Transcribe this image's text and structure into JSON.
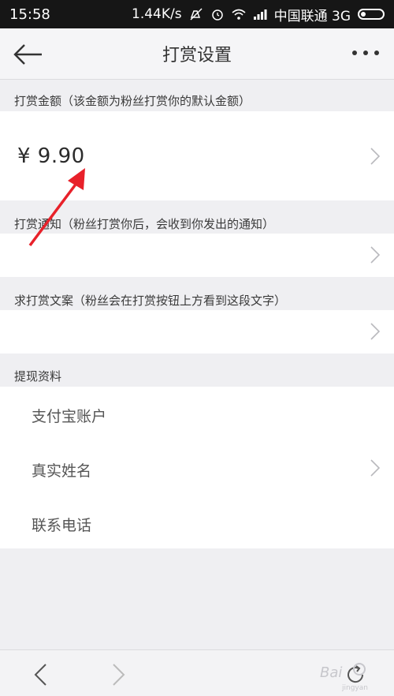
{
  "status_bar": {
    "time": "15:58",
    "speed": "1.44K/s",
    "carrier": "中国联通 3G",
    "icons": [
      "mute-icon",
      "alarm-icon",
      "wifi-icon",
      "signal-icon",
      "battery-icon"
    ]
  },
  "header": {
    "title": "打赏设置",
    "back_icon": "back-arrow-icon",
    "more_icon": "more-dots-icon"
  },
  "sections": {
    "amount": {
      "label": "打赏金额（该金额为粉丝打赏你的默认金额）",
      "value": "¥ 9.90"
    },
    "notice": {
      "label": "打赏通知（粉丝打赏你后，会收到你发出的通知）",
      "value": ""
    },
    "copy": {
      "label": "求打赏文案（粉丝会在打赏按钮上方看到这段文字）",
      "value": ""
    },
    "withdraw": {
      "label": "提现资料",
      "items": [
        "支付宝账户",
        "真实姓名",
        "联系电话"
      ]
    }
  },
  "bottom_bar": {
    "icons": [
      "back-icon",
      "forward-icon",
      "refresh-icon"
    ]
  },
  "colors": {
    "status_bg": "#161616",
    "page_bg": "#efeff2",
    "arrow_annotation": "#e8212a"
  }
}
